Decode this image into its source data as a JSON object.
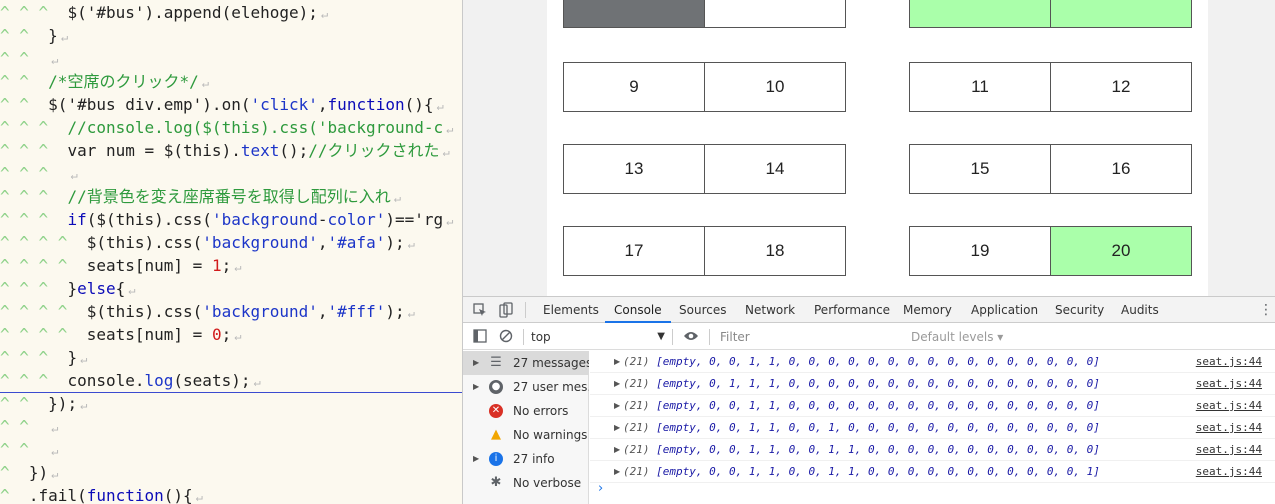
{
  "editor": {
    "lines": [
      {
        "indent": 3,
        "tokens": [
          {
            "t": "$('#bus').append(elehoge);",
            "c": ""
          }
        ]
      },
      {
        "indent": 2,
        "tokens": [
          {
            "t": "}",
            "c": ""
          }
        ]
      },
      {
        "indent": 2,
        "tokens": []
      },
      {
        "indent": 2,
        "tokens": [
          {
            "t": "/*空席のクリック*/",
            "c": "t-cm"
          }
        ]
      },
      {
        "indent": 2,
        "tokens": [
          {
            "t": "$('#bus div.emp').on(",
            "c": ""
          },
          {
            "t": "'click'",
            "c": "t-str"
          },
          {
            "t": ",",
            "c": ""
          },
          {
            "t": "function",
            "c": "t-kw"
          },
          {
            "t": "(){",
            "c": ""
          }
        ]
      },
      {
        "indent": 3,
        "tokens": [
          {
            "t": "//console.log($(this).css('background-c",
            "c": "t-cm"
          }
        ]
      },
      {
        "indent": 3,
        "tokens": [
          {
            "t": "var num = $(this).",
            "c": ""
          },
          {
            "t": "text",
            "c": "t-fn"
          },
          {
            "t": "();",
            "c": ""
          },
          {
            "t": "//クリックされた",
            "c": "t-cm"
          }
        ]
      },
      {
        "indent": 3,
        "tokens": []
      },
      {
        "indent": 3,
        "tokens": [
          {
            "t": "//背景色を変え座席番号を取得し配列に入れ",
            "c": "t-cm"
          }
        ]
      },
      {
        "indent": 3,
        "tokens": [
          {
            "t": "if",
            "c": "t-kw"
          },
          {
            "t": "($(this).css(",
            "c": ""
          },
          {
            "t": "'background",
            "c": "t-str"
          },
          {
            "t": "-",
            "c": ""
          },
          {
            "t": "color'",
            "c": "t-str"
          },
          {
            "t": ")=='rg",
            "c": ""
          }
        ]
      },
      {
        "indent": 4,
        "tokens": [
          {
            "t": "$(this).css(",
            "c": ""
          },
          {
            "t": "'background'",
            "c": "t-str"
          },
          {
            "t": ",",
            "c": ""
          },
          {
            "t": "'#afa'",
            "c": "t-str"
          },
          {
            "t": ");",
            "c": ""
          }
        ]
      },
      {
        "indent": 4,
        "tokens": [
          {
            "t": "seats[num] = ",
            "c": ""
          },
          {
            "t": "1",
            "c": "t-num"
          },
          {
            "t": ";",
            "c": ""
          }
        ]
      },
      {
        "indent": 3,
        "tokens": [
          {
            "t": "}",
            "c": ""
          },
          {
            "t": "else",
            "c": "t-kw"
          },
          {
            "t": "{",
            "c": ""
          }
        ]
      },
      {
        "indent": 4,
        "tokens": [
          {
            "t": "$(this).css(",
            "c": ""
          },
          {
            "t": "'background'",
            "c": "t-str"
          },
          {
            "t": ",",
            "c": ""
          },
          {
            "t": "'#fff'",
            "c": "t-str"
          },
          {
            "t": ");",
            "c": ""
          }
        ]
      },
      {
        "indent": 4,
        "tokens": [
          {
            "t": "seats[num] = ",
            "c": ""
          },
          {
            "t": "0",
            "c": "t-num"
          },
          {
            "t": ";",
            "c": ""
          }
        ]
      },
      {
        "indent": 3,
        "tokens": [
          {
            "t": "}",
            "c": ""
          }
        ]
      },
      {
        "indent": 3,
        "tokens": [
          {
            "t": "console.",
            "c": ""
          },
          {
            "t": "log",
            "c": "t-fn"
          },
          {
            "t": "(seats);",
            "c": ""
          }
        ]
      },
      {
        "indent": 2,
        "tokens": [
          {
            "t": "});",
            "c": ""
          }
        ]
      },
      {
        "indent": 2,
        "tokens": []
      },
      {
        "indent": 2,
        "tokens": []
      },
      {
        "indent": 1,
        "tokens": [
          {
            "t": "})",
            "c": ""
          }
        ]
      },
      {
        "indent": 1,
        "tokens": [
          {
            "t": ".fail(",
            "c": ""
          },
          {
            "t": "function",
            "c": "t-kw"
          },
          {
            "t": "(){",
            "c": ""
          }
        ]
      }
    ]
  },
  "bus": {
    "seats": [
      {
        "label": "",
        "state": "occupied"
      },
      {
        "label": "",
        "state": "empty"
      },
      {
        "label": "",
        "state": "selected"
      },
      {
        "label": "",
        "state": "selected"
      },
      {
        "label": "9",
        "state": "empty"
      },
      {
        "label": "10",
        "state": "empty"
      },
      {
        "label": "11",
        "state": "empty"
      },
      {
        "label": "12",
        "state": "empty"
      },
      {
        "label": "13",
        "state": "empty"
      },
      {
        "label": "14",
        "state": "empty"
      },
      {
        "label": "15",
        "state": "empty"
      },
      {
        "label": "16",
        "state": "empty"
      },
      {
        "label": "17",
        "state": "empty"
      },
      {
        "label": "18",
        "state": "empty"
      },
      {
        "label": "19",
        "state": "empty"
      },
      {
        "label": "20",
        "state": "selected"
      }
    ]
  },
  "colors": {
    "seat_empty": "#ffffff",
    "seat_selected": "#aaffaa",
    "seat_occupied": "#6f7275",
    "devtools_accent": "#1a73e8"
  },
  "devtools": {
    "tabs": [
      "Elements",
      "Console",
      "Sources",
      "Network",
      "Performance",
      "Memory",
      "Application",
      "Security",
      "Audits"
    ],
    "active_tab": "Console",
    "context": "top",
    "filter_placeholder": "Filter",
    "levels_label": "Default levels ▾",
    "sidebar": [
      {
        "label": "27 messages",
        "icon": "list-icon",
        "expandable": true
      },
      {
        "label": "27 user mes…",
        "icon": "user-icon",
        "expandable": true
      },
      {
        "label": "No errors",
        "icon": "error-icon",
        "expandable": false
      },
      {
        "label": "No warnings",
        "icon": "warning-icon",
        "expandable": false
      },
      {
        "label": "27 info",
        "icon": "info-icon",
        "expandable": true
      },
      {
        "label": "No verbose",
        "icon": "bug-icon",
        "expandable": false
      }
    ],
    "logs": [
      {
        "count": "(21)",
        "text": "[empty, 0, 0, 1, 1, 0, 0, 0, 0, 0, 0, 0, 0, 0, 0, 0, 0, 0, 0, 0, 0]",
        "source": "seat.js:44"
      },
      {
        "count": "(21)",
        "text": "[empty, 0, 1, 1, 1, 0, 0, 0, 0, 0, 0, 0, 0, 0, 0, 0, 0, 0, 0, 0, 0]",
        "source": "seat.js:44"
      },
      {
        "count": "(21)",
        "text": "[empty, 0, 0, 1, 1, 0, 0, 0, 0, 0, 0, 0, 0, 0, 0, 0, 0, 0, 0, 0, 0]",
        "source": "seat.js:44"
      },
      {
        "count": "(21)",
        "text": "[empty, 0, 0, 1, 1, 0, 0, 1, 0, 0, 0, 0, 0, 0, 0, 0, 0, 0, 0, 0, 0]",
        "source": "seat.js:44"
      },
      {
        "count": "(21)",
        "text": "[empty, 0, 0, 1, 1, 0, 0, 1, 1, 0, 0, 0, 0, 0, 0, 0, 0, 0, 0, 0, 0]",
        "source": "seat.js:44"
      },
      {
        "count": "(21)",
        "text": "[empty, 0, 0, 1, 1, 0, 0, 1, 1, 0, 0, 0, 0, 0, 0, 0, 0, 0, 0, 0, 1]",
        "source": "seat.js:44"
      }
    ]
  }
}
